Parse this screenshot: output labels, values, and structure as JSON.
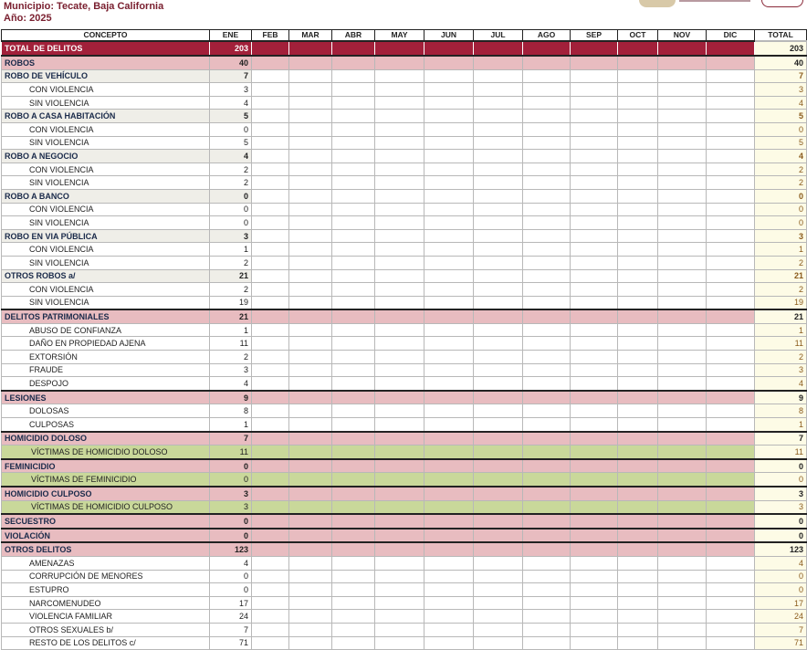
{
  "header": {
    "municipio": "Municipio: Tecate, Baja California",
    "anio": "Año: 2025"
  },
  "columns": [
    "CONCEPTO",
    "ENE",
    "FEB",
    "MAR",
    "ABR",
    "MAY",
    "JUN",
    "JUL",
    "AGO",
    "SEP",
    "OCT",
    "NOV",
    "DIC",
    "TOTAL"
  ],
  "rows": [
    {
      "kind": "total",
      "label": "TOTAL DE DELITOS",
      "ene": "203",
      "total": "203"
    },
    {
      "kind": "group",
      "label": "ROBOS",
      "ene": "40",
      "total": "40"
    },
    {
      "kind": "cat",
      "label": "ROBO DE VEHÍCULO",
      "ene": "7",
      "total": "7"
    },
    {
      "kind": "sub",
      "label": "CON VIOLENCIA",
      "ene": "3",
      "total": "3"
    },
    {
      "kind": "sub",
      "label": "SIN VIOLENCIA",
      "ene": "4",
      "total": "4"
    },
    {
      "kind": "cat",
      "label": "ROBO A CASA HABITACIÓN",
      "ene": "5",
      "total": "5"
    },
    {
      "kind": "sub",
      "label": "CON VIOLENCIA",
      "ene": "0",
      "total": "0"
    },
    {
      "kind": "sub",
      "label": "SIN VIOLENCIA",
      "ene": "5",
      "total": "5"
    },
    {
      "kind": "cat",
      "label": "ROBO A NEGOCIO",
      "ene": "4",
      "total": "4"
    },
    {
      "kind": "sub",
      "label": "CON VIOLENCIA",
      "ene": "2",
      "total": "2"
    },
    {
      "kind": "sub",
      "label": "SIN VIOLENCIA",
      "ene": "2",
      "total": "2"
    },
    {
      "kind": "cat",
      "label": "ROBO A BANCO",
      "ene": "0",
      "total": "0"
    },
    {
      "kind": "sub",
      "label": "CON VIOLENCIA",
      "ene": "0",
      "total": "0"
    },
    {
      "kind": "sub",
      "label": "SIN VIOLENCIA",
      "ene": "0",
      "total": "0"
    },
    {
      "kind": "cat",
      "label": "ROBO EN VIA PÚBLICA",
      "ene": "3",
      "total": "3"
    },
    {
      "kind": "sub",
      "label": "CON VIOLENCIA",
      "ene": "1",
      "total": "1"
    },
    {
      "kind": "sub",
      "label": "SIN VIOLENCIA",
      "ene": "2",
      "total": "2"
    },
    {
      "kind": "cat",
      "label": "OTROS ROBOS a/",
      "ene": "21",
      "total": "21"
    },
    {
      "kind": "sub",
      "label": "CON VIOLENCIA",
      "ene": "2",
      "total": "2"
    },
    {
      "kind": "sub",
      "label": "SIN VIOLENCIA",
      "ene": "19",
      "total": "19"
    },
    {
      "kind": "group",
      "label": "DELITOS PATRIMONIALES",
      "ene": "21",
      "total": "21"
    },
    {
      "kind": "sub",
      "label": "ABUSO DE CONFIANZA",
      "ene": "1",
      "total": "1"
    },
    {
      "kind": "sub",
      "label": "DAÑO EN PROPIEDAD AJENA",
      "ene": "11",
      "total": "11"
    },
    {
      "kind": "sub",
      "label": "EXTORSIÓN",
      "ene": "2",
      "total": "2"
    },
    {
      "kind": "sub",
      "label": "FRAUDE",
      "ene": "3",
      "total": "3"
    },
    {
      "kind": "sub",
      "label": "DESPOJO",
      "ene": "4",
      "total": "4"
    },
    {
      "kind": "group",
      "label": "LESIONES",
      "ene": "9",
      "total": "9"
    },
    {
      "kind": "sub",
      "label": "DOLOSAS",
      "ene": "8",
      "total": "8"
    },
    {
      "kind": "sub",
      "label": "CULPOSAS",
      "ene": "1",
      "total": "1"
    },
    {
      "kind": "group",
      "label": "HOMICIDIO DOLOSO",
      "ene": "7",
      "total": "7"
    },
    {
      "kind": "green",
      "label": "VÍCTIMAS DE HOMICIDIO DOLOSO",
      "ene": "11",
      "total": "11"
    },
    {
      "kind": "group",
      "label": "FEMINICIDIO",
      "ene": "0",
      "total": "0"
    },
    {
      "kind": "green",
      "label": "VÍCTIMAS DE FEMINICIDIO",
      "ene": "0",
      "total": "0"
    },
    {
      "kind": "group",
      "label": "HOMICIDIO CULPOSO",
      "ene": "3",
      "total": "3"
    },
    {
      "kind": "green",
      "label": "VÍCTIMAS DE HOMICIDIO CULPOSO",
      "ene": "3",
      "total": "3"
    },
    {
      "kind": "group",
      "label": "SECUESTRO",
      "ene": "0",
      "total": "0"
    },
    {
      "kind": "group",
      "label": "VIOLACIÓN",
      "ene": "0",
      "total": "0"
    },
    {
      "kind": "group",
      "label": "OTROS DELITOS",
      "ene": "123",
      "total": "123"
    },
    {
      "kind": "sub",
      "label": "AMENAZAS",
      "ene": "4",
      "total": "4"
    },
    {
      "kind": "sub",
      "label": "CORRUPCIÓN DE MENORES",
      "ene": "0",
      "total": "0"
    },
    {
      "kind": "sub",
      "label": "ESTUPRO",
      "ene": "0",
      "total": "0"
    },
    {
      "kind": "sub",
      "label": "NARCOMENUDEO",
      "ene": "17",
      "total": "17"
    },
    {
      "kind": "sub",
      "label": "VIOLENCIA FAMILIAR",
      "ene": "24",
      "total": "24"
    },
    {
      "kind": "sub",
      "label": "OTROS SEXUALES b/",
      "ene": "7",
      "total": "7"
    },
    {
      "kind": "sub",
      "label": "RESTO DE LOS DELITOS c/",
      "ene": "71",
      "total": "71"
    }
  ]
}
